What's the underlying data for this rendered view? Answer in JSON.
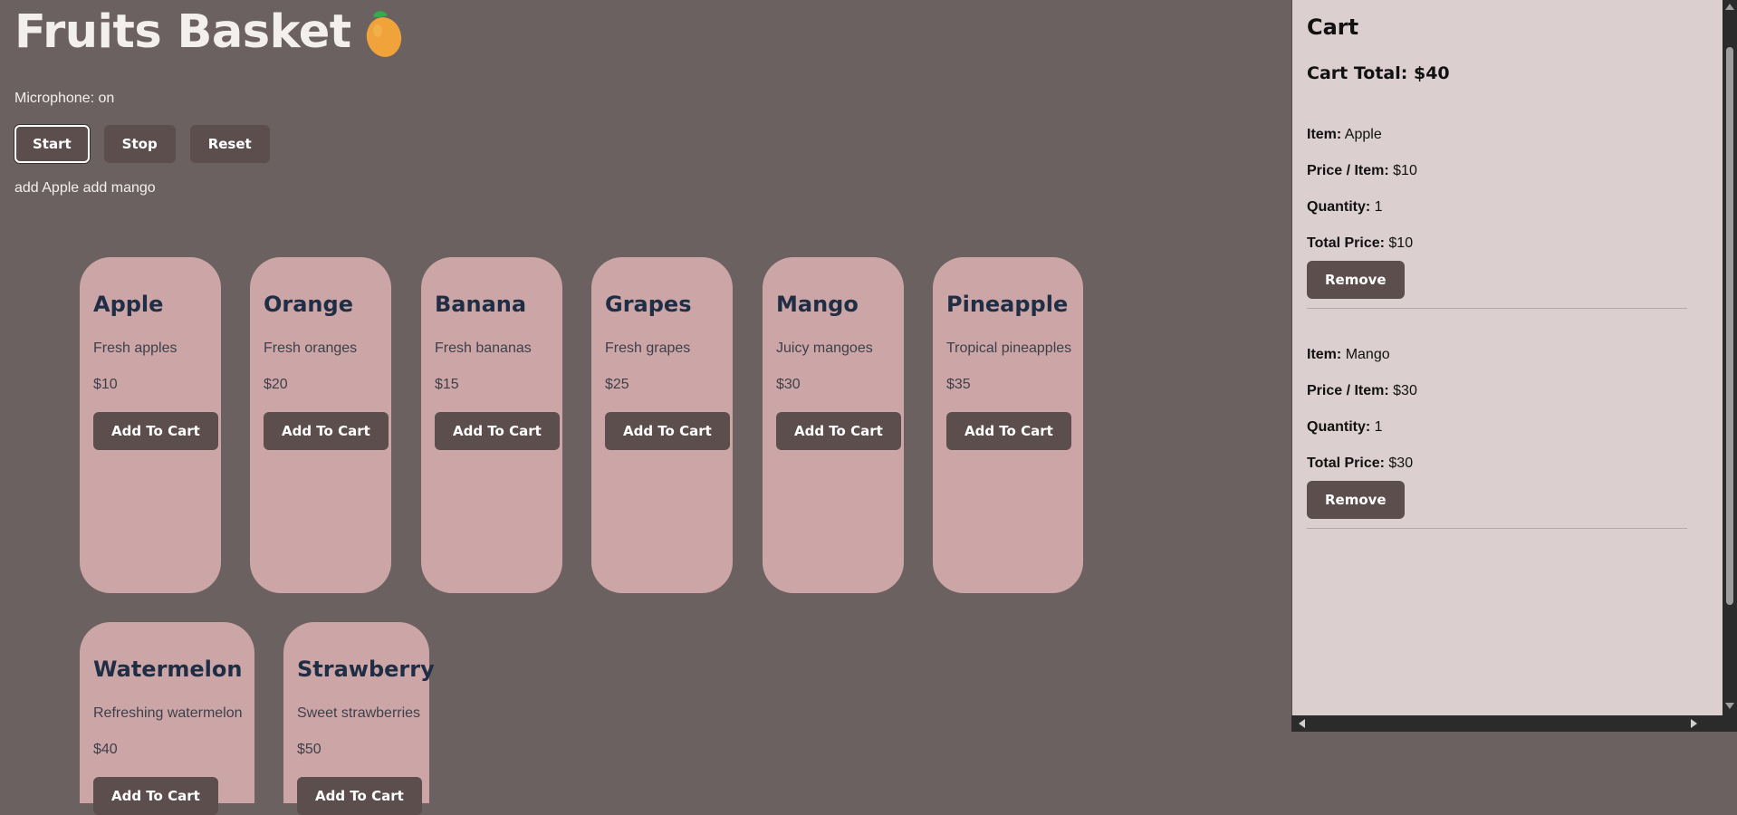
{
  "header": {
    "title": "Fruits Basket",
    "icon": "mango-icon"
  },
  "voice": {
    "mic_label": "Microphone: on",
    "start_label": "Start",
    "stop_label": "Stop",
    "reset_label": "Reset",
    "transcript": "add Apple add mango"
  },
  "products": [
    {
      "name": "Apple",
      "desc": "Fresh apples",
      "price": "$10",
      "button": "Add To Cart"
    },
    {
      "name": "Orange",
      "desc": "Fresh oranges",
      "price": "$20",
      "button": "Add To Cart"
    },
    {
      "name": "Banana",
      "desc": "Fresh bananas",
      "price": "$15",
      "button": "Add To Cart"
    },
    {
      "name": "Grapes",
      "desc": "Fresh grapes",
      "price": "$25",
      "button": "Add To Cart"
    },
    {
      "name": "Mango",
      "desc": "Juicy mangoes",
      "price": "$30",
      "button": "Add To Cart"
    },
    {
      "name": "Pineapple",
      "desc": "Tropical pineapples",
      "price": "$35",
      "button": "Add To Cart"
    },
    {
      "name": "Watermelon",
      "desc": "Refreshing watermelon",
      "price": "$40",
      "button": "Add To Cart"
    },
    {
      "name": "Strawberry",
      "desc": "Sweet strawberries",
      "price": "$50",
      "button": "Add To Cart"
    }
  ],
  "cart": {
    "title": "Cart",
    "total_label": "Cart Total:",
    "total_value": "$40",
    "item_label": "Item:",
    "price_label": "Price / Item:",
    "qty_label": "Quantity:",
    "total_price_label": "Total Price:",
    "remove_label": "Remove",
    "items": [
      {
        "name": "Apple",
        "price": "$10",
        "quantity": "1",
        "total": "$10"
      },
      {
        "name": "Mango",
        "price": "$30",
        "quantity": "1",
        "total": "$30"
      }
    ]
  },
  "colors": {
    "page_bg": "#6b6160",
    "card_bg": "#cca6a6",
    "button_bg": "#5c4e4d",
    "cart_bg": "#dccfcf",
    "heading": "#1f2d45"
  }
}
